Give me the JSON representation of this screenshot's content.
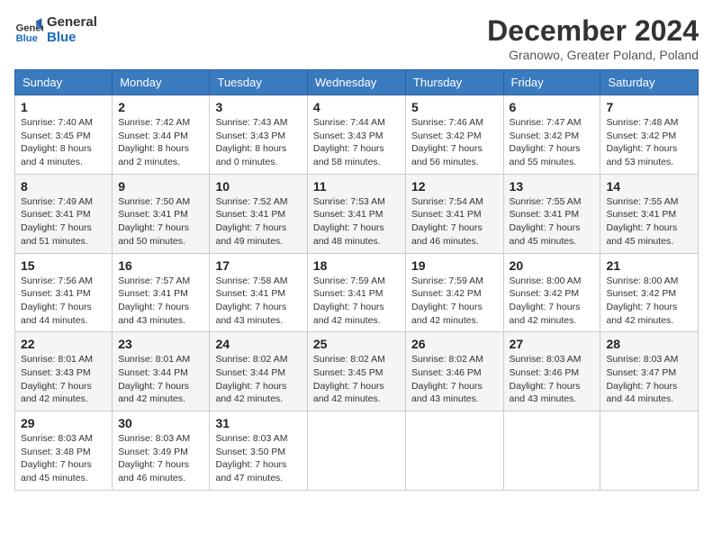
{
  "header": {
    "logo_line1": "General",
    "logo_line2": "Blue",
    "month": "December 2024",
    "location": "Granowo, Greater Poland, Poland"
  },
  "days_of_week": [
    "Sunday",
    "Monday",
    "Tuesday",
    "Wednesday",
    "Thursday",
    "Friday",
    "Saturday"
  ],
  "weeks": [
    [
      {
        "day": "1",
        "info": "Sunrise: 7:40 AM\nSunset: 3:45 PM\nDaylight: 8 hours\nand 4 minutes."
      },
      {
        "day": "2",
        "info": "Sunrise: 7:42 AM\nSunset: 3:44 PM\nDaylight: 8 hours\nand 2 minutes."
      },
      {
        "day": "3",
        "info": "Sunrise: 7:43 AM\nSunset: 3:43 PM\nDaylight: 8 hours\nand 0 minutes."
      },
      {
        "day": "4",
        "info": "Sunrise: 7:44 AM\nSunset: 3:43 PM\nDaylight: 7 hours\nand 58 minutes."
      },
      {
        "day": "5",
        "info": "Sunrise: 7:46 AM\nSunset: 3:42 PM\nDaylight: 7 hours\nand 56 minutes."
      },
      {
        "day": "6",
        "info": "Sunrise: 7:47 AM\nSunset: 3:42 PM\nDaylight: 7 hours\nand 55 minutes."
      },
      {
        "day": "7",
        "info": "Sunrise: 7:48 AM\nSunset: 3:42 PM\nDaylight: 7 hours\nand 53 minutes."
      }
    ],
    [
      {
        "day": "8",
        "info": "Sunrise: 7:49 AM\nSunset: 3:41 PM\nDaylight: 7 hours\nand 51 minutes."
      },
      {
        "day": "9",
        "info": "Sunrise: 7:50 AM\nSunset: 3:41 PM\nDaylight: 7 hours\nand 50 minutes."
      },
      {
        "day": "10",
        "info": "Sunrise: 7:52 AM\nSunset: 3:41 PM\nDaylight: 7 hours\nand 49 minutes."
      },
      {
        "day": "11",
        "info": "Sunrise: 7:53 AM\nSunset: 3:41 PM\nDaylight: 7 hours\nand 48 minutes."
      },
      {
        "day": "12",
        "info": "Sunrise: 7:54 AM\nSunset: 3:41 PM\nDaylight: 7 hours\nand 46 minutes."
      },
      {
        "day": "13",
        "info": "Sunrise: 7:55 AM\nSunset: 3:41 PM\nDaylight: 7 hours\nand 45 minutes."
      },
      {
        "day": "14",
        "info": "Sunrise: 7:55 AM\nSunset: 3:41 PM\nDaylight: 7 hours\nand 45 minutes."
      }
    ],
    [
      {
        "day": "15",
        "info": "Sunrise: 7:56 AM\nSunset: 3:41 PM\nDaylight: 7 hours\nand 44 minutes."
      },
      {
        "day": "16",
        "info": "Sunrise: 7:57 AM\nSunset: 3:41 PM\nDaylight: 7 hours\nand 43 minutes."
      },
      {
        "day": "17",
        "info": "Sunrise: 7:58 AM\nSunset: 3:41 PM\nDaylight: 7 hours\nand 43 minutes."
      },
      {
        "day": "18",
        "info": "Sunrise: 7:59 AM\nSunset: 3:41 PM\nDaylight: 7 hours\nand 42 minutes."
      },
      {
        "day": "19",
        "info": "Sunrise: 7:59 AM\nSunset: 3:42 PM\nDaylight: 7 hours\nand 42 minutes."
      },
      {
        "day": "20",
        "info": "Sunrise: 8:00 AM\nSunset: 3:42 PM\nDaylight: 7 hours\nand 42 minutes."
      },
      {
        "day": "21",
        "info": "Sunrise: 8:00 AM\nSunset: 3:42 PM\nDaylight: 7 hours\nand 42 minutes."
      }
    ],
    [
      {
        "day": "22",
        "info": "Sunrise: 8:01 AM\nSunset: 3:43 PM\nDaylight: 7 hours\nand 42 minutes."
      },
      {
        "day": "23",
        "info": "Sunrise: 8:01 AM\nSunset: 3:44 PM\nDaylight: 7 hours\nand 42 minutes."
      },
      {
        "day": "24",
        "info": "Sunrise: 8:02 AM\nSunset: 3:44 PM\nDaylight: 7 hours\nand 42 minutes."
      },
      {
        "day": "25",
        "info": "Sunrise: 8:02 AM\nSunset: 3:45 PM\nDaylight: 7 hours\nand 42 minutes."
      },
      {
        "day": "26",
        "info": "Sunrise: 8:02 AM\nSunset: 3:46 PM\nDaylight: 7 hours\nand 43 minutes."
      },
      {
        "day": "27",
        "info": "Sunrise: 8:03 AM\nSunset: 3:46 PM\nDaylight: 7 hours\nand 43 minutes."
      },
      {
        "day": "28",
        "info": "Sunrise: 8:03 AM\nSunset: 3:47 PM\nDaylight: 7 hours\nand 44 minutes."
      }
    ],
    [
      {
        "day": "29",
        "info": "Sunrise: 8:03 AM\nSunset: 3:48 PM\nDaylight: 7 hours\nand 45 minutes."
      },
      {
        "day": "30",
        "info": "Sunrise: 8:03 AM\nSunset: 3:49 PM\nDaylight: 7 hours\nand 46 minutes."
      },
      {
        "day": "31",
        "info": "Sunrise: 8:03 AM\nSunset: 3:50 PM\nDaylight: 7 hours\nand 47 minutes."
      },
      null,
      null,
      null,
      null
    ]
  ]
}
